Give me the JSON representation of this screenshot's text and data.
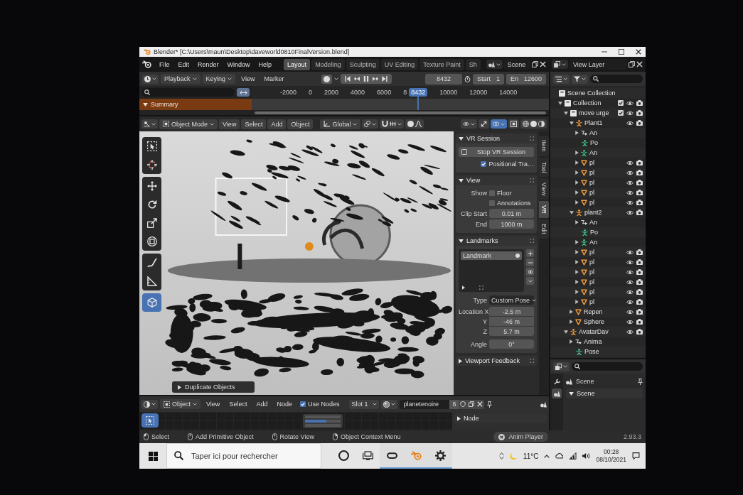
{
  "window": {
    "title": "Blender* [C:\\Users\\maun\\Desktop\\daveworld0810FinalVersion.blend]"
  },
  "menu": [
    "File",
    "Edit",
    "Render",
    "Window",
    "Help"
  ],
  "workspaces": [
    {
      "label": "Layout",
      "selected": true
    },
    {
      "label": "Modeling",
      "selected": false
    },
    {
      "label": "Sculpting",
      "selected": false
    },
    {
      "label": "UV Editing",
      "selected": false
    },
    {
      "label": "Texture Paint",
      "selected": false
    },
    {
      "label": "Sh",
      "selected": false
    }
  ],
  "scene": {
    "value": "Scene"
  },
  "view_layer": {
    "value": "View Layer"
  },
  "timeline": {
    "menus": [
      {
        "label": "Playback",
        "kind": "dropdown"
      },
      {
        "label": "Keying",
        "kind": "dropdown"
      },
      {
        "label": "View",
        "kind": "menu"
      },
      {
        "label": "Marker",
        "kind": "menu"
      }
    ],
    "playing": true,
    "current_frame": "8432",
    "start": {
      "label": "Start",
      "value": "1"
    },
    "end": {
      "label": "En",
      "value": "12600"
    },
    "ruler": [
      {
        "label": "-2000",
        "kind": "tick"
      },
      {
        "label": "0",
        "kind": "tick"
      },
      {
        "label": "2000",
        "kind": "tick"
      },
      {
        "label": "4000",
        "kind": "tick"
      },
      {
        "label": "6000",
        "kind": "tick"
      },
      {
        "label": "8",
        "kind": "tick"
      },
      {
        "label": "8432",
        "kind": "playhead"
      },
      {
        "label": "10000",
        "kind": "tick"
      },
      {
        "label": "12000",
        "kind": "tick"
      },
      {
        "label": "14000",
        "kind": "tick"
      }
    ],
    "channels": [
      {
        "label": "Summary",
        "expanded": true
      }
    ]
  },
  "viewport": {
    "mode": "Object Mode",
    "menus": [
      "View",
      "Select",
      "Add",
      "Object"
    ],
    "orientation": "Global",
    "tool_groups": [
      [
        {
          "kind": "select-box",
          "selected": false
        },
        {
          "kind": "cursor",
          "selected": false
        }
      ],
      [
        {
          "kind": "move",
          "selected": false
        },
        {
          "kind": "rotate",
          "selected": false
        },
        {
          "kind": "scale",
          "selected": false
        },
        {
          "kind": "transform",
          "selected": false
        }
      ],
      [
        {
          "kind": "annotate",
          "selected": false
        },
        {
          "kind": "measure",
          "selected": false
        }
      ],
      [
        {
          "kind": "add-cube",
          "selected": true
        }
      ]
    ],
    "last_operator": {
      "label": "Duplicate Objects",
      "expanded": false
    }
  },
  "sidebar": {
    "tabs": [
      {
        "label": "Item",
        "selected": false
      },
      {
        "label": "Tool",
        "selected": false
      },
      {
        "label": "View",
        "selected": false
      },
      {
        "label": "VR",
        "selected": true
      },
      {
        "label": "Edit",
        "selected": false
      }
    ],
    "vr_session": {
      "title": "VR Session",
      "expanded": true,
      "button": "Stop VR Session",
      "positional_tracking": {
        "label": "Positional Tra…",
        "checked": true
      }
    },
    "view": {
      "title": "View",
      "expanded": true,
      "show_label": "Show",
      "options": [
        {
          "label": "Floor",
          "checked": false
        },
        {
          "label": "Annotations",
          "checked": false
        }
      ],
      "fields": [
        {
          "label": "Clip Start",
          "value": "0.01 m"
        },
        {
          "label": "End",
          "value": "1000 m"
        }
      ]
    },
    "landmarks": {
      "title": "Landmarks",
      "expanded": true,
      "items": [
        {
          "label": "Landmark",
          "selected": true
        }
      ],
      "type": {
        "label": "Type",
        "value": "Custom Pose"
      },
      "location": [
        {
          "label": "Location X",
          "value": "-2.5 m"
        },
        {
          "label": "Y",
          "value": "-46 m"
        },
        {
          "label": "Z",
          "value": "5.7 m"
        }
      ],
      "angle": {
        "label": "Angle",
        "value": "0°"
      }
    },
    "viewport_feedback": {
      "title": "Viewport Feedback",
      "expanded": false
    }
  },
  "outliner": {
    "tree": [
      {
        "label": "Scene Collection",
        "kind": "scene-collection",
        "children": [
          {
            "label": "Collection",
            "kind": "collection",
            "expanded": true,
            "checked": true,
            "children": [
              {
                "label": "move urge",
                "kind": "collection",
                "expanded": true,
                "checked": true,
                "children": [
                  {
                    "label": "Plant1",
                    "kind": "armature",
                    "expanded": true,
                    "children": [
                      {
                        "label": "An",
                        "kind": "action",
                        "expanded": false
                      },
                      {
                        "label": "Po",
                        "kind": "pose"
                      },
                      {
                        "label": "An",
                        "kind": "armature-data",
                        "expanded": false
                      },
                      {
                        "label": "pl",
                        "kind": "mesh",
                        "expanded": false
                      },
                      {
                        "label": "pl",
                        "kind": "mesh",
                        "expanded": false
                      },
                      {
                        "label": "pl",
                        "kind": "mesh",
                        "expanded": false
                      },
                      {
                        "label": "pl",
                        "kind": "mesh",
                        "expanded": false
                      },
                      {
                        "label": "pl",
                        "kind": "mesh",
                        "expanded": false
                      }
                    ]
                  },
                  {
                    "label": "plant2",
                    "kind": "armature",
                    "expanded": true,
                    "children": [
                      {
                        "label": "An",
                        "kind": "action",
                        "expanded": false
                      },
                      {
                        "label": "Po",
                        "kind": "pose"
                      },
                      {
                        "label": "An",
                        "kind": "armature-data",
                        "expanded": false
                      },
                      {
                        "label": "pl",
                        "kind": "mesh",
                        "expanded": false
                      },
                      {
                        "label": "pl",
                        "kind": "mesh",
                        "expanded": false
                      },
                      {
                        "label": "pl",
                        "kind": "mesh",
                        "expanded": false
                      },
                      {
                        "label": "pl",
                        "kind": "mesh",
                        "expanded": false
                      },
                      {
                        "label": "pl",
                        "kind": "mesh",
                        "expanded": false
                      },
                      {
                        "label": "pl",
                        "kind": "mesh",
                        "expanded": false
                      }
                    ]
                  },
                  {
                    "label": "Repen",
                    "kind": "mesh",
                    "expanded": false
                  },
                  {
                    "label": "Sphere",
                    "kind": "mesh",
                    "expanded": false
                  }
                ]
              },
              {
                "label": "AvatarDav",
                "kind": "armature",
                "expanded": true,
                "children": [
                  {
                    "label": "Anima",
                    "kind": "action",
                    "expanded": false
                  },
                  {
                    "label": "Pose",
                    "kind": "pose"
                  }
                ]
              }
            ]
          }
        ]
      }
    ]
  },
  "properties": {
    "tabs": [
      {
        "kind": "tool",
        "selected": false
      },
      {
        "kind": "scene",
        "selected": true
      }
    ],
    "context": "Scene",
    "panels": [
      {
        "title": "Scene",
        "expanded": true
      }
    ]
  },
  "node_editor": {
    "object_type": "Object",
    "menus": [
      "View",
      "Select",
      "Add",
      "Node"
    ],
    "use_nodes": {
      "label": "Use Nodes",
      "checked": true
    },
    "slot": "Slot 1",
    "material": "planetenoire",
    "users": "6",
    "tools": [
      {
        "kind": "select-box",
        "selected": true
      }
    ],
    "sidebar_panel": {
      "title": "Node",
      "expanded": false
    }
  },
  "status_bar": {
    "hints": [
      {
        "kind": "mouse-left",
        "label": "Select"
      },
      {
        "kind": "mouse-middle",
        "label": "Add Primitive Object"
      },
      {
        "kind": "mouse-middle",
        "label": "Rotate View"
      },
      {
        "kind": "mouse-right",
        "label": "Object Context Menu"
      }
    ],
    "job": "Anim Player",
    "version": "2.93.3"
  },
  "taskbar": {
    "search": {
      "placeholder": "Taper ici pour rechercher"
    },
    "apps": [
      {
        "kind": "headset",
        "running": true
      },
      {
        "kind": "blender",
        "running": true
      },
      {
        "kind": "settings",
        "running": true
      }
    ],
    "temperature": "11°C",
    "time": "00:28",
    "date": "08/10/2021"
  }
}
